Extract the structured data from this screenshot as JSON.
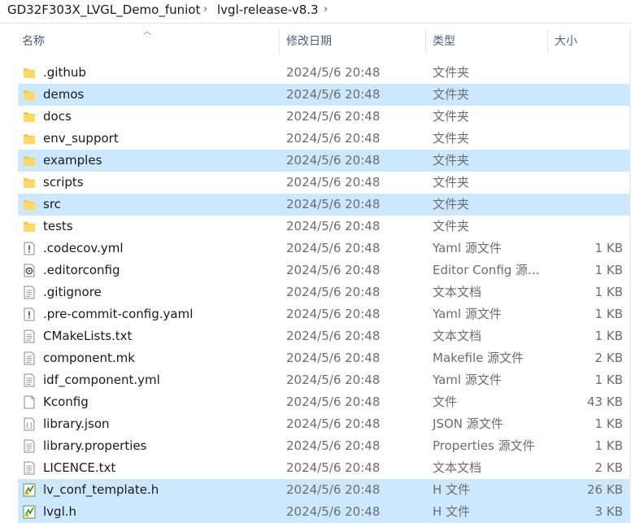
{
  "breadcrumb": {
    "items": [
      "GD32F303X_LVGL_Demo_funiot",
      "lvgl-release-v8.3"
    ],
    "separator": "›"
  },
  "columns": {
    "name": "名称",
    "date": "修改日期",
    "type": "类型",
    "size": "大小"
  },
  "colors": {
    "selected": "#cce8ff",
    "folder": "#f6c744",
    "header_text": "#4d6082"
  },
  "files": [
    {
      "name": ".github",
      "date": "2024/5/6 20:48",
      "type": "文件夹",
      "size": "",
      "icon": "folder-icon",
      "selected": false
    },
    {
      "name": "demos",
      "date": "2024/5/6 20:48",
      "type": "文件夹",
      "size": "",
      "icon": "folder-icon",
      "selected": true
    },
    {
      "name": "docs",
      "date": "2024/5/6 20:48",
      "type": "文件夹",
      "size": "",
      "icon": "folder-icon",
      "selected": false
    },
    {
      "name": "env_support",
      "date": "2024/5/6 20:48",
      "type": "文件夹",
      "size": "",
      "icon": "folder-icon",
      "selected": false
    },
    {
      "name": "examples",
      "date": "2024/5/6 20:48",
      "type": "文件夹",
      "size": "",
      "icon": "folder-icon",
      "selected": true
    },
    {
      "name": "scripts",
      "date": "2024/5/6 20:48",
      "type": "文件夹",
      "size": "",
      "icon": "folder-icon",
      "selected": false
    },
    {
      "name": "src",
      "date": "2024/5/6 20:48",
      "type": "文件夹",
      "size": "",
      "icon": "folder-icon",
      "selected": true
    },
    {
      "name": "tests",
      "date": "2024/5/6 20:48",
      "type": "文件夹",
      "size": "",
      "icon": "folder-icon",
      "selected": false
    },
    {
      "name": ".codecov.yml",
      "date": "2024/5/6 20:48",
      "type": "Yaml 源文件",
      "size": "1 KB",
      "icon": "yaml-file-icon",
      "selected": false
    },
    {
      "name": ".editorconfig",
      "date": "2024/5/6 20:48",
      "type": "Editor Config 源...",
      "size": "1 KB",
      "icon": "config-file-icon",
      "selected": false
    },
    {
      "name": ".gitignore",
      "date": "2024/5/6 20:48",
      "type": "文本文档",
      "size": "1 KB",
      "icon": "text-file-icon",
      "selected": false
    },
    {
      "name": ".pre-commit-config.yaml",
      "date": "2024/5/6 20:48",
      "type": "Yaml 源文件",
      "size": "1 KB",
      "icon": "yaml-file-icon",
      "selected": false
    },
    {
      "name": "CMakeLists.txt",
      "date": "2024/5/6 20:48",
      "type": "文本文档",
      "size": "1 KB",
      "icon": "text-file-icon",
      "selected": false
    },
    {
      "name": "component.mk",
      "date": "2024/5/6 20:48",
      "type": "Makefile 源文件",
      "size": "2 KB",
      "icon": "text-file-icon",
      "selected": false
    },
    {
      "name": "idf_component.yml",
      "date": "2024/5/6 20:48",
      "type": "Yaml 源文件",
      "size": "1 KB",
      "icon": "text-file-icon",
      "selected": false
    },
    {
      "name": "Kconfig",
      "date": "2024/5/6 20:48",
      "type": "文件",
      "size": "43 KB",
      "icon": "blank-file-icon",
      "selected": false
    },
    {
      "name": "library.json",
      "date": "2024/5/6 20:48",
      "type": "JSON 源文件",
      "size": "1 KB",
      "icon": "json-file-icon",
      "selected": false
    },
    {
      "name": "library.properties",
      "date": "2024/5/6 20:48",
      "type": "Properties 源文件",
      "size": "1 KB",
      "icon": "text-file-icon",
      "selected": false
    },
    {
      "name": "LICENCE.txt",
      "date": "2024/5/6 20:48",
      "type": "文本文档",
      "size": "2 KB",
      "icon": "text-file-icon",
      "selected": false
    },
    {
      "name": "lv_conf_template.h",
      "date": "2024/5/6 20:48",
      "type": "H 文件",
      "size": "26 KB",
      "icon": "header-file-icon",
      "selected": true
    },
    {
      "name": "lvgl.h",
      "date": "2024/5/6 20:48",
      "type": "H 文件",
      "size": "3 KB",
      "icon": "header-file-icon",
      "selected": true
    }
  ]
}
